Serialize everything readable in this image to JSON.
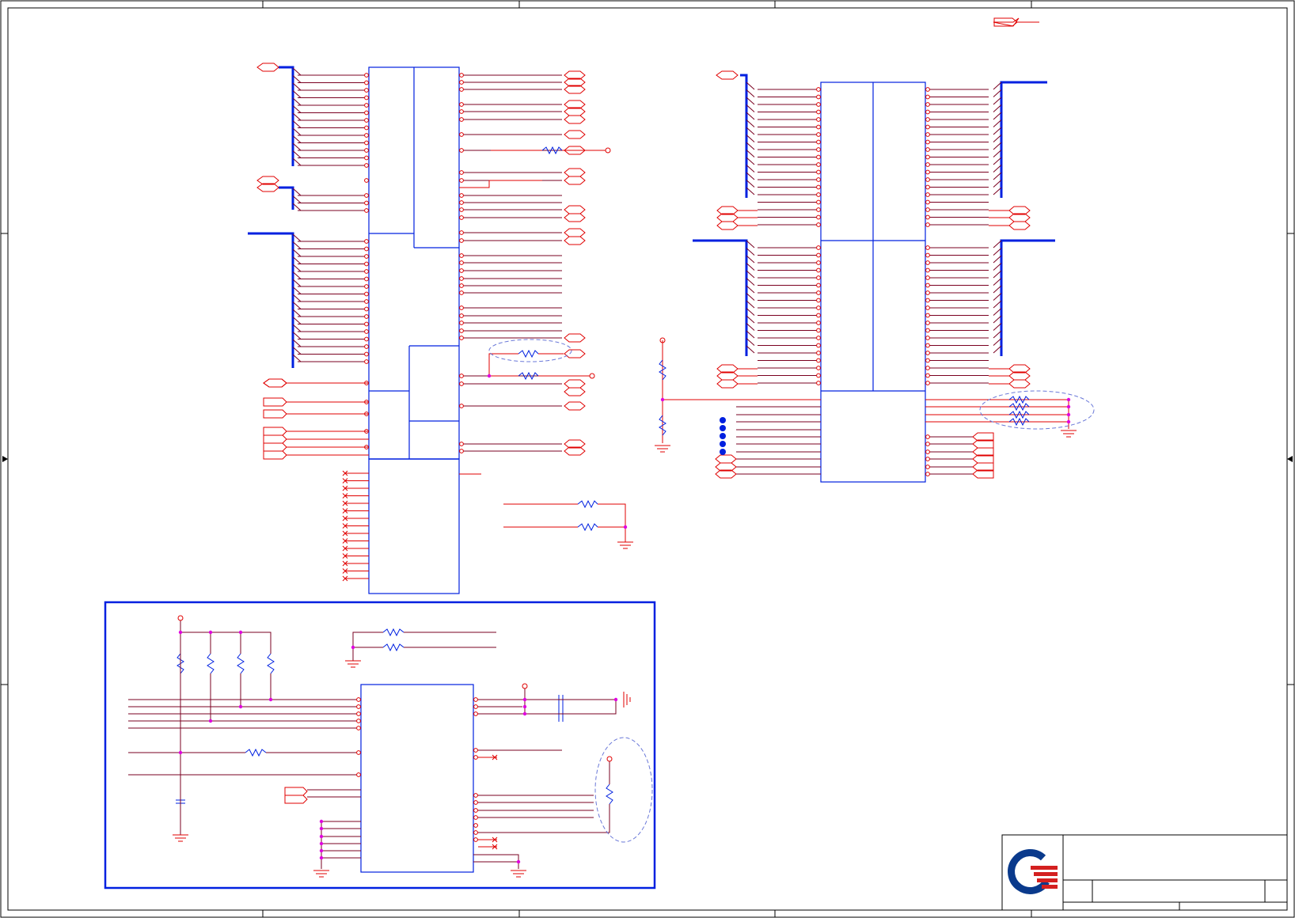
{
  "sheet": {
    "title": "",
    "drawing_number": "",
    "revision": "",
    "sheet_number": "",
    "colors": {
      "border": "#000000",
      "wire": "#e00000",
      "wire_dark": "#7a0020",
      "bus": "#0020e0",
      "component": "#0020e0",
      "junction": "#e000e0",
      "dashed_outline": "#6a78d8",
      "logo_blue": "#0a3a8c",
      "logo_red": "#d42020"
    },
    "logo": {
      "icon": "company-logo-icon"
    }
  }
}
